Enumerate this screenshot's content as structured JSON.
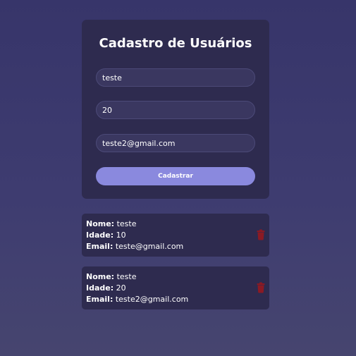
{
  "colors": {
    "background": "#3a386c",
    "card": "#2e2b4f",
    "input": "#3a3760",
    "button": "#8a89de",
    "delete": "#8b1a24",
    "text": "#ffffff"
  },
  "form": {
    "title": "Cadastro de Usuários",
    "name_value": "teste",
    "age_value": "20",
    "email_value": "teste2@gmail.com",
    "submit_label": "Cadastrar"
  },
  "users": [
    {
      "name_label": "Nome:",
      "name": "teste",
      "age_label": "Idade:",
      "age": "10",
      "email_label": "Email:",
      "email": "teste@gmail.com",
      "delete_icon": "trash-icon"
    },
    {
      "name_label": "Nome:",
      "name": "teste",
      "age_label": "Idade:",
      "age": "20",
      "email_label": "Email:",
      "email": "teste2@gmail.com",
      "delete_icon": "trash-icon"
    }
  ]
}
